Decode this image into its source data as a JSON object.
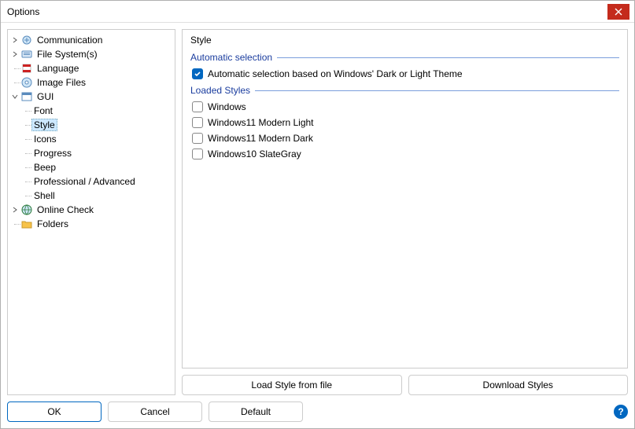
{
  "window": {
    "title": "Options"
  },
  "tree": {
    "items": [
      {
        "label": "Communication"
      },
      {
        "label": "File System(s)"
      },
      {
        "label": "Language"
      },
      {
        "label": "Image Files"
      },
      {
        "label": "GUI"
      },
      {
        "label": "Font"
      },
      {
        "label": "Style"
      },
      {
        "label": "Icons"
      },
      {
        "label": "Progress"
      },
      {
        "label": "Beep"
      },
      {
        "label": "Professional / Advanced"
      },
      {
        "label": "Shell"
      },
      {
        "label": "Online Check"
      },
      {
        "label": "Folders"
      }
    ]
  },
  "panel": {
    "title": "Style",
    "group1": "Automatic selection",
    "auto_cb": "Automatic selection based on Windows' Dark or Light Theme",
    "group2": "Loaded Styles",
    "styles": [
      {
        "label": "Windows"
      },
      {
        "label": "Windows11 Modern Light"
      },
      {
        "label": "Windows11 Modern Dark"
      },
      {
        "label": "Windows10 SlateGray"
      }
    ]
  },
  "buttons": {
    "load": "Load Style from file",
    "download": "Download Styles",
    "ok": "OK",
    "cancel": "Cancel",
    "default": "Default"
  }
}
